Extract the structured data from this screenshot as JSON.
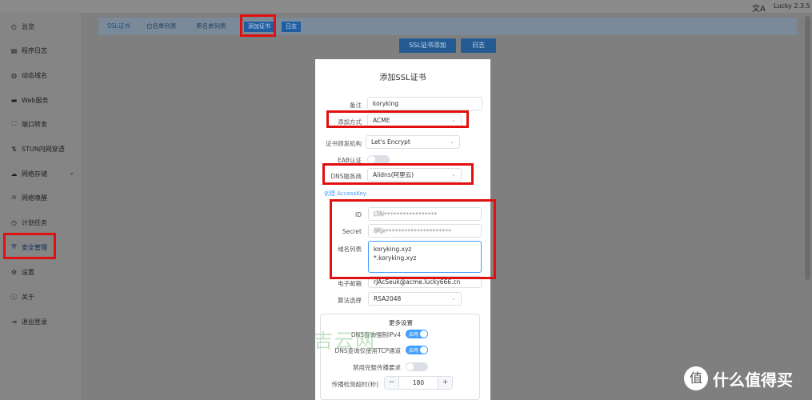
{
  "topbar": {
    "lang_icon": "文A",
    "version": "Lucky 2.3.5"
  },
  "sidebar": {
    "items": [
      {
        "label": "总览",
        "icon": "dashboard-icon",
        "glyph": "◴"
      },
      {
        "label": "程序日志",
        "icon": "log-icon",
        "glyph": "▤"
      },
      {
        "label": "动态域名",
        "icon": "globe-icon",
        "glyph": "◍"
      },
      {
        "label": "Web服务",
        "icon": "server-icon",
        "glyph": "▬"
      },
      {
        "label": "端口转发",
        "icon": "forward-icon",
        "glyph": "⛶"
      },
      {
        "label": "STUN内网穿透",
        "icon": "arrows-icon",
        "glyph": "⇅"
      },
      {
        "label": "网络存储",
        "icon": "cloud-icon",
        "glyph": "☁"
      },
      {
        "label": "网络唤醒",
        "icon": "bell-icon",
        "glyph": "⍾"
      },
      {
        "label": "计划任务",
        "icon": "clock-icon",
        "glyph": "◷"
      },
      {
        "label": "安全管理",
        "icon": "shield-icon",
        "glyph": "⛨"
      },
      {
        "label": "设置",
        "icon": "gear-icon",
        "glyph": "⚙"
      },
      {
        "label": "关于",
        "icon": "info-icon",
        "glyph": "ⓘ"
      },
      {
        "label": "退出登录",
        "icon": "logout-icon",
        "glyph": "⇥"
      }
    ],
    "chevron": "⌄"
  },
  "tabs": [
    {
      "label": "SSL证书"
    },
    {
      "label": "白名单列表"
    },
    {
      "label": "黑名单列表"
    },
    {
      "label": "添加证书"
    },
    {
      "label": "日志"
    }
  ],
  "actions": {
    "ssl_add": "SSL证书添加",
    "log": "日志"
  },
  "dialog": {
    "title": "添加SSL证书",
    "fields": {
      "remark": {
        "label": "备注",
        "value": "koryking"
      },
      "add_method": {
        "label": "添加方式",
        "value": "ACME"
      },
      "ca": {
        "label": "证书颁发机构",
        "value": "Let's Encrypt"
      },
      "eab": {
        "label": "EAB认证"
      },
      "dns_provider": {
        "label": "DNS服务商",
        "value": "Alidns(阿里云)"
      },
      "create_key_link": "创建 AccessKey",
      "id": {
        "label": "ID",
        "value": "LTAI•••••••••••••••••"
      },
      "secret": {
        "label": "Secret",
        "value": "8Rjx•••••••••••••••••••••"
      },
      "domains": {
        "label": "域名列表",
        "lines": [
          "koryking.xyz",
          "*.koryking.xyz"
        ]
      },
      "email": {
        "label": "电子邮箱",
        "value": "rJAcSeuk@acme.lucky666.cn"
      },
      "algorithm": {
        "label": "算法选择",
        "value": "RSA2048"
      }
    },
    "more": {
      "title": "更多设置",
      "dns_ipv4": {
        "label": "DNS查询强制IPv4",
        "state": "启用"
      },
      "dns_tcp": {
        "label": "DNS查询仅使用TCP通道",
        "state": "启用"
      },
      "disable_propagation": {
        "label": "禁用完整传播要求"
      },
      "timeout": {
        "label": "传播检测超时(秒)",
        "value": "180",
        "minus": "−",
        "plus": "+"
      }
    },
    "arrow": "⌄"
  },
  "watermark": "吉云网",
  "brand": {
    "logo": "值",
    "text": "什么值得买"
  },
  "colors": {
    "accent": "#409eff",
    "highlight_box": "#e01010",
    "active_tab_bg": "#1f5ea0"
  }
}
